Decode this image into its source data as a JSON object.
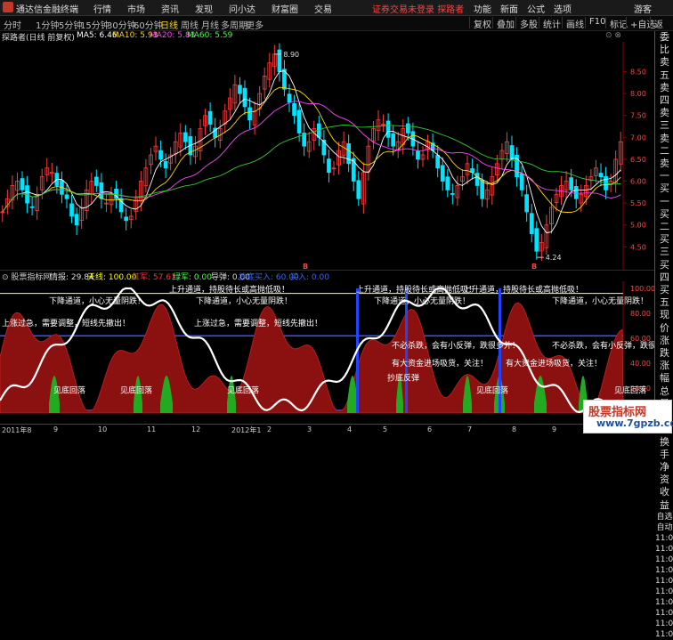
{
  "titlebar": {
    "app_name": "通达信金融终端",
    "menu": [
      "行情",
      "市场",
      "资讯",
      "发现",
      "问小达",
      "财富圈",
      "交易"
    ],
    "warning": "证券交易未登录",
    "warning2": "探路者",
    "right_menu": [
      "功能",
      "新面",
      "公式",
      "选项"
    ],
    "guest": "游客"
  },
  "periods": [
    "分时",
    "1分钟",
    "5分钟",
    "15分钟",
    "30分钟",
    "60分钟",
    "日线",
    "周线",
    "月线",
    "多周期",
    "更多"
  ],
  "period_active": "日线",
  "tool_buttons": [
    "复权",
    "叠加",
    "多股",
    "统计",
    "画线",
    "F10",
    "标记",
    "+自选",
    "返回"
  ],
  "main": {
    "stock": "探路者(日线 前复权)",
    "ma5": "MA5: 6.46",
    "ma10": "MA10: 5.93",
    "ma20": "MA20: 5.83",
    "ma60": "MA60: 5.59",
    "high_label": "8.90",
    "low_label": "4.24",
    "price_ticks": [
      "8.50",
      "8.00",
      "7.50",
      "7.00",
      "6.50",
      "6.00",
      "5.50",
      "5.00",
      "4.50"
    ],
    "b_marks": [
      "B",
      "B"
    ]
  },
  "indicator": {
    "name": "股票指标网",
    "info": "情报: 29.84",
    "tianxian": "天线: 100.00",
    "hongjun": "红军: 57.61",
    "lvjun": "绿军: 0.00",
    "daodan": "导弹: 0.00",
    "bottom_sig": "抄底买入: 60.00",
    "buy": "买入: 0.00",
    "ticks": [
      "100.00",
      "80.00",
      "60.00",
      "40.00",
      "20.00"
    ]
  },
  "annotations": {
    "up_channel": "上升通道，持股待长或高抛低吸！",
    "down_channel": "下降通道，小心无量阴跌！",
    "overheat": "上涨过急，需要调整，短线先撤出！",
    "dont_chase": "不必杀跌，会有小反弹，跌很多外！",
    "big_money": "有大资金进场吸货，关注！",
    "rebound": "抄底反弹",
    "see_bottom": "见底回落",
    "enter_signal": "进场信号"
  },
  "time_axis": [
    "2011年8",
    "9",
    "10",
    "11",
    "12",
    "2012年1",
    "2",
    "3",
    "4",
    "5",
    "6",
    "7",
    "8",
    "9",
    "10"
  ],
  "right_panel": [
    "委比",
    "卖五",
    "卖四",
    "卖三",
    "卖二",
    "卖一",
    "买一",
    "买二",
    "买三",
    "买四",
    "买五",
    "现价",
    "涨跌",
    "涨幅",
    "总量",
    "外盘",
    "换手",
    "净资",
    "收益"
  ],
  "right_panel2": [
    "自选",
    "自动",
    "11:07",
    "11:07",
    "11:07",
    "11:07",
    "11:07",
    "11:07",
    "11:07",
    "11:07",
    "11:07",
    "11:07"
  ],
  "watermark": {
    "line1": "股票指标网",
    "line2": "www.7gpzb.com"
  },
  "chart_data": {
    "type": "candlestick",
    "ylim": [
      4.1,
      9.1
    ],
    "closes": [
      5.3,
      5.6,
      5.9,
      6.0,
      5.8,
      5.5,
      5.4,
      5.7,
      6.1,
      6.3,
      6.2,
      5.9,
      5.7,
      5.6,
      5.2,
      5.0,
      5.4,
      5.8,
      6.0,
      5.9,
      5.6,
      5.5,
      5.7,
      5.6,
      5.3,
      5.1,
      5.2,
      5.6,
      6.0,
      6.3,
      6.6,
      6.8,
      6.5,
      6.3,
      6.6,
      6.9,
      7.1,
      6.9,
      6.6,
      6.8,
      7.2,
      7.5,
      7.3,
      7.0,
      7.2,
      7.6,
      7.9,
      8.2,
      8.0,
      7.7,
      7.4,
      7.6,
      8.0,
      8.4,
      8.7,
      8.9,
      8.5,
      8.1,
      7.8,
      7.5,
      7.1,
      6.8,
      6.9,
      7.2,
      7.0,
      6.6,
      6.2,
      6.3,
      6.7,
      6.9,
      6.4,
      6.0,
      5.6,
      6.2,
      6.8,
      7.2,
      7.4,
      7.3,
      7.0,
      6.8,
      6.9,
      7.2,
      7.1,
      6.8,
      6.5,
      6.6,
      6.9,
      6.7,
      6.3,
      6.0,
      5.8,
      5.7,
      5.9,
      6.1,
      6.4,
      6.2,
      5.9,
      5.6,
      5.8,
      6.1,
      6.4,
      6.7,
      6.9,
      6.5,
      6.1,
      5.8,
      5.3,
      4.8,
      4.4,
      4.6,
      5.0,
      5.4,
      5.7,
      5.9,
      6.0,
      5.8,
      5.6,
      5.7,
      5.9,
      6.1,
      6.3,
      6.1,
      5.8,
      6.0,
      6.5,
      6.9
    ]
  }
}
